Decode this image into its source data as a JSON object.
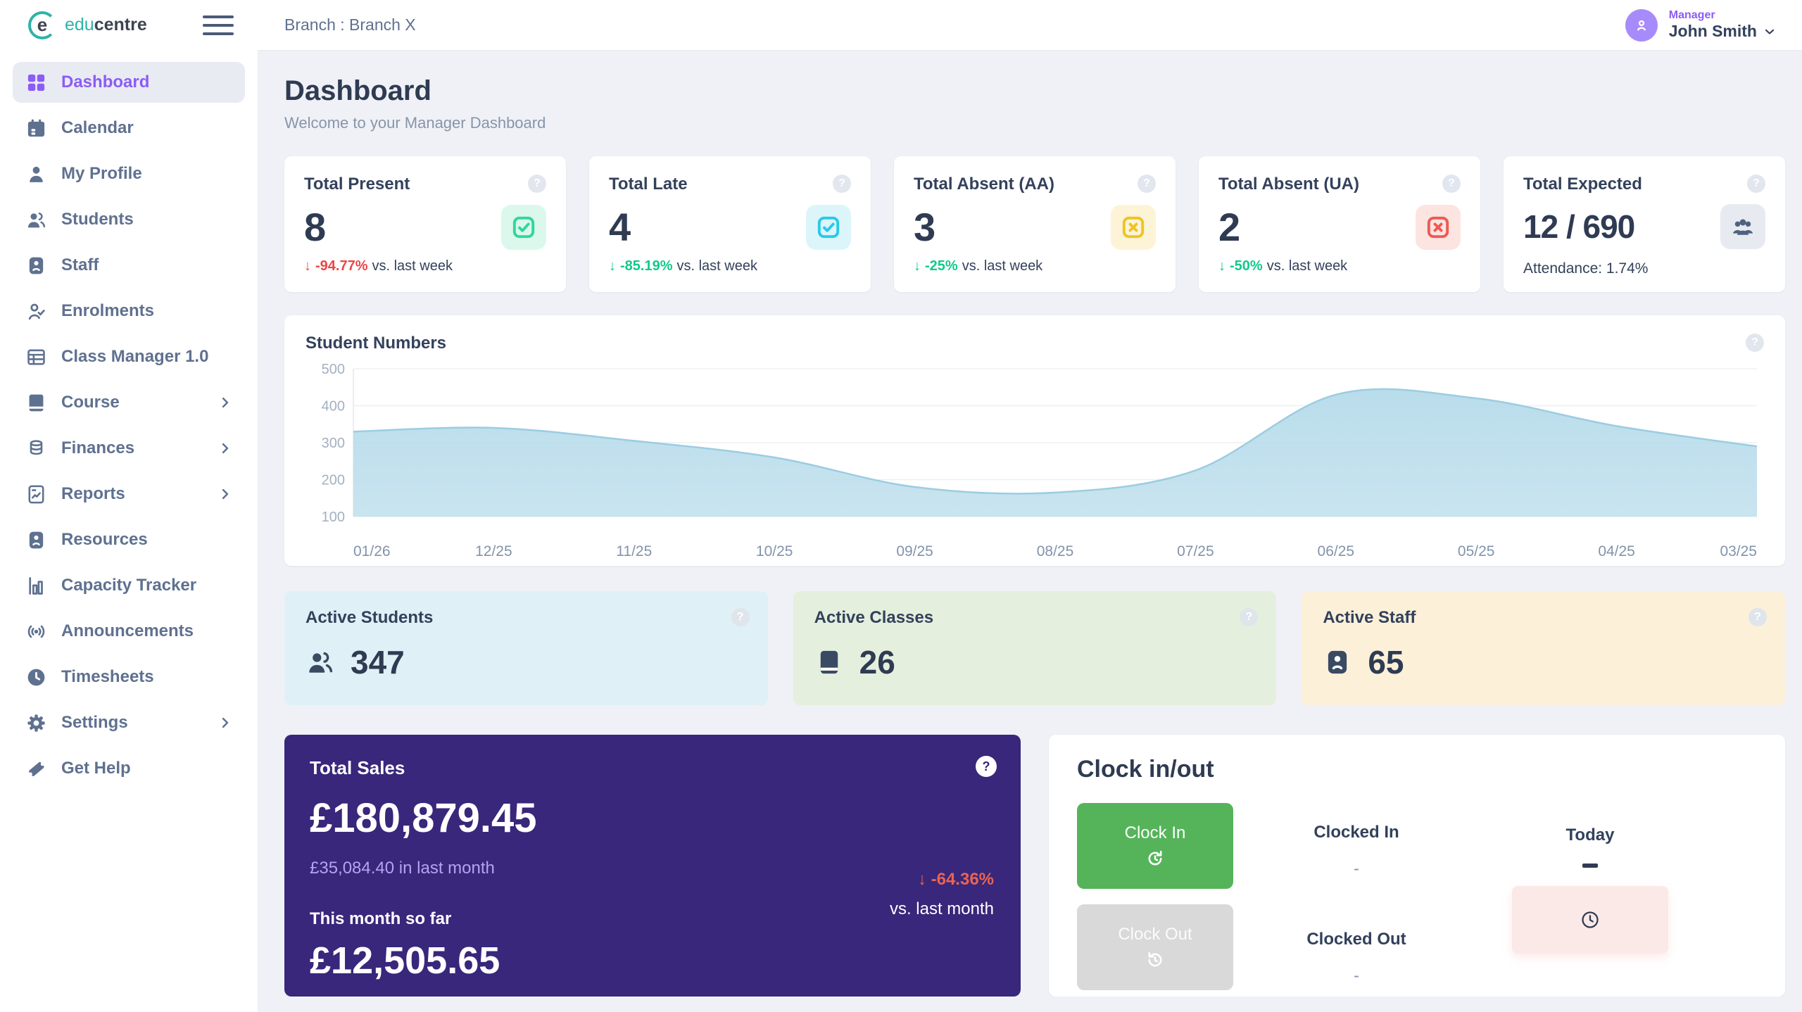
{
  "colors": {
    "accent_purple": "#8b5cf6",
    "sales_bg": "#38277b",
    "positive": "#10c98d",
    "negative": "#ef4444",
    "present_icon": "#2fd7a0",
    "late_icon": "#29c9e8",
    "absent_aa_icon": "#edc425",
    "absent_ua_icon": "#ee5a52",
    "chart_fill": "#b6dbea",
    "clock_in_btn": "#55b45a",
    "clock_out_btn": "#d9d9d9",
    "today_panel": "#fbe9e7"
  },
  "icons": {
    "help": "?"
  },
  "brand": {
    "logo_e": "e",
    "logo_edu": "edu",
    "logo_centre": "centre"
  },
  "topbar": {
    "branch": "Branch : Branch X",
    "role": "Manager",
    "user": "John Smith"
  },
  "sidebar": [
    {
      "label": "Dashboard"
    },
    {
      "label": "Calendar"
    },
    {
      "label": "My Profile"
    },
    {
      "label": "Students"
    },
    {
      "label": "Staff"
    },
    {
      "label": "Enrolments"
    },
    {
      "label": "Class Manager 1.0"
    },
    {
      "label": "Course"
    },
    {
      "label": "Finances"
    },
    {
      "label": "Reports"
    },
    {
      "label": "Resources"
    },
    {
      "label": "Capacity Tracker"
    },
    {
      "label": "Announcements"
    },
    {
      "label": "Timesheets"
    },
    {
      "label": "Settings"
    },
    {
      "label": "Get Help"
    }
  ],
  "page": {
    "title": "Dashboard",
    "subtitle": "Welcome to your Manager Dashboard"
  },
  "stats": [
    {
      "title": "Total Present",
      "value": "8",
      "delta_arrow": "↓",
      "delta": "-94.77%",
      "delta_note": "vs. last week"
    },
    {
      "title": "Total Late",
      "value": "4",
      "delta_arrow": "↓",
      "delta": "-85.19%",
      "delta_note": "vs. last week"
    },
    {
      "title": "Total Absent (AA)",
      "value": "3",
      "delta_arrow": "↓",
      "delta": "-25%",
      "delta_note": "vs. last week"
    },
    {
      "title": "Total Absent (UA)",
      "value": "2",
      "delta_arrow": "↓",
      "delta": "-50%",
      "delta_note": "vs. last week"
    },
    {
      "title": "Total Expected",
      "value": "12 / 690",
      "note": "Attendance: 1.74%"
    }
  ],
  "chart_data": {
    "type": "area",
    "title": "Student Numbers",
    "x": [
      "01/26",
      "12/25",
      "11/25",
      "10/25",
      "09/25",
      "08/25",
      "07/25",
      "06/25",
      "05/25",
      "04/25",
      "03/25"
    ],
    "values": [
      330,
      340,
      305,
      260,
      180,
      165,
      225,
      430,
      420,
      345,
      290
    ],
    "xlabel": "",
    "ylabel": "",
    "ylim": [
      100,
      500
    ],
    "yticks": [
      500,
      400,
      300,
      200,
      100
    ],
    "grid": true,
    "legend": "none",
    "fill_color": "#b6dbea",
    "line_color": "#9bcde1"
  },
  "active_cards": [
    {
      "title": "Active Students",
      "value": "347"
    },
    {
      "title": "Active Classes",
      "value": "26"
    },
    {
      "title": "Active Staff",
      "value": "65"
    }
  ],
  "sales": {
    "title": "Total Sales",
    "total": "£180,879.45",
    "last_month_amount": "£35,084.40",
    "last_month_suffix": " in last month",
    "month_label": "This month so far",
    "month_value": "£12,505.65",
    "delta_arrow": "↓",
    "delta": "-64.36%",
    "delta_note": "vs. last month"
  },
  "clock": {
    "title": "Clock in/out",
    "clock_in": "Clock In",
    "clock_out": "Clock Out",
    "clocked_in_label": "Clocked In",
    "clocked_in_value": "-",
    "clocked_out_label": "Clocked Out",
    "clocked_out_value": "-",
    "today_label": "Today",
    "today_value": "—"
  }
}
